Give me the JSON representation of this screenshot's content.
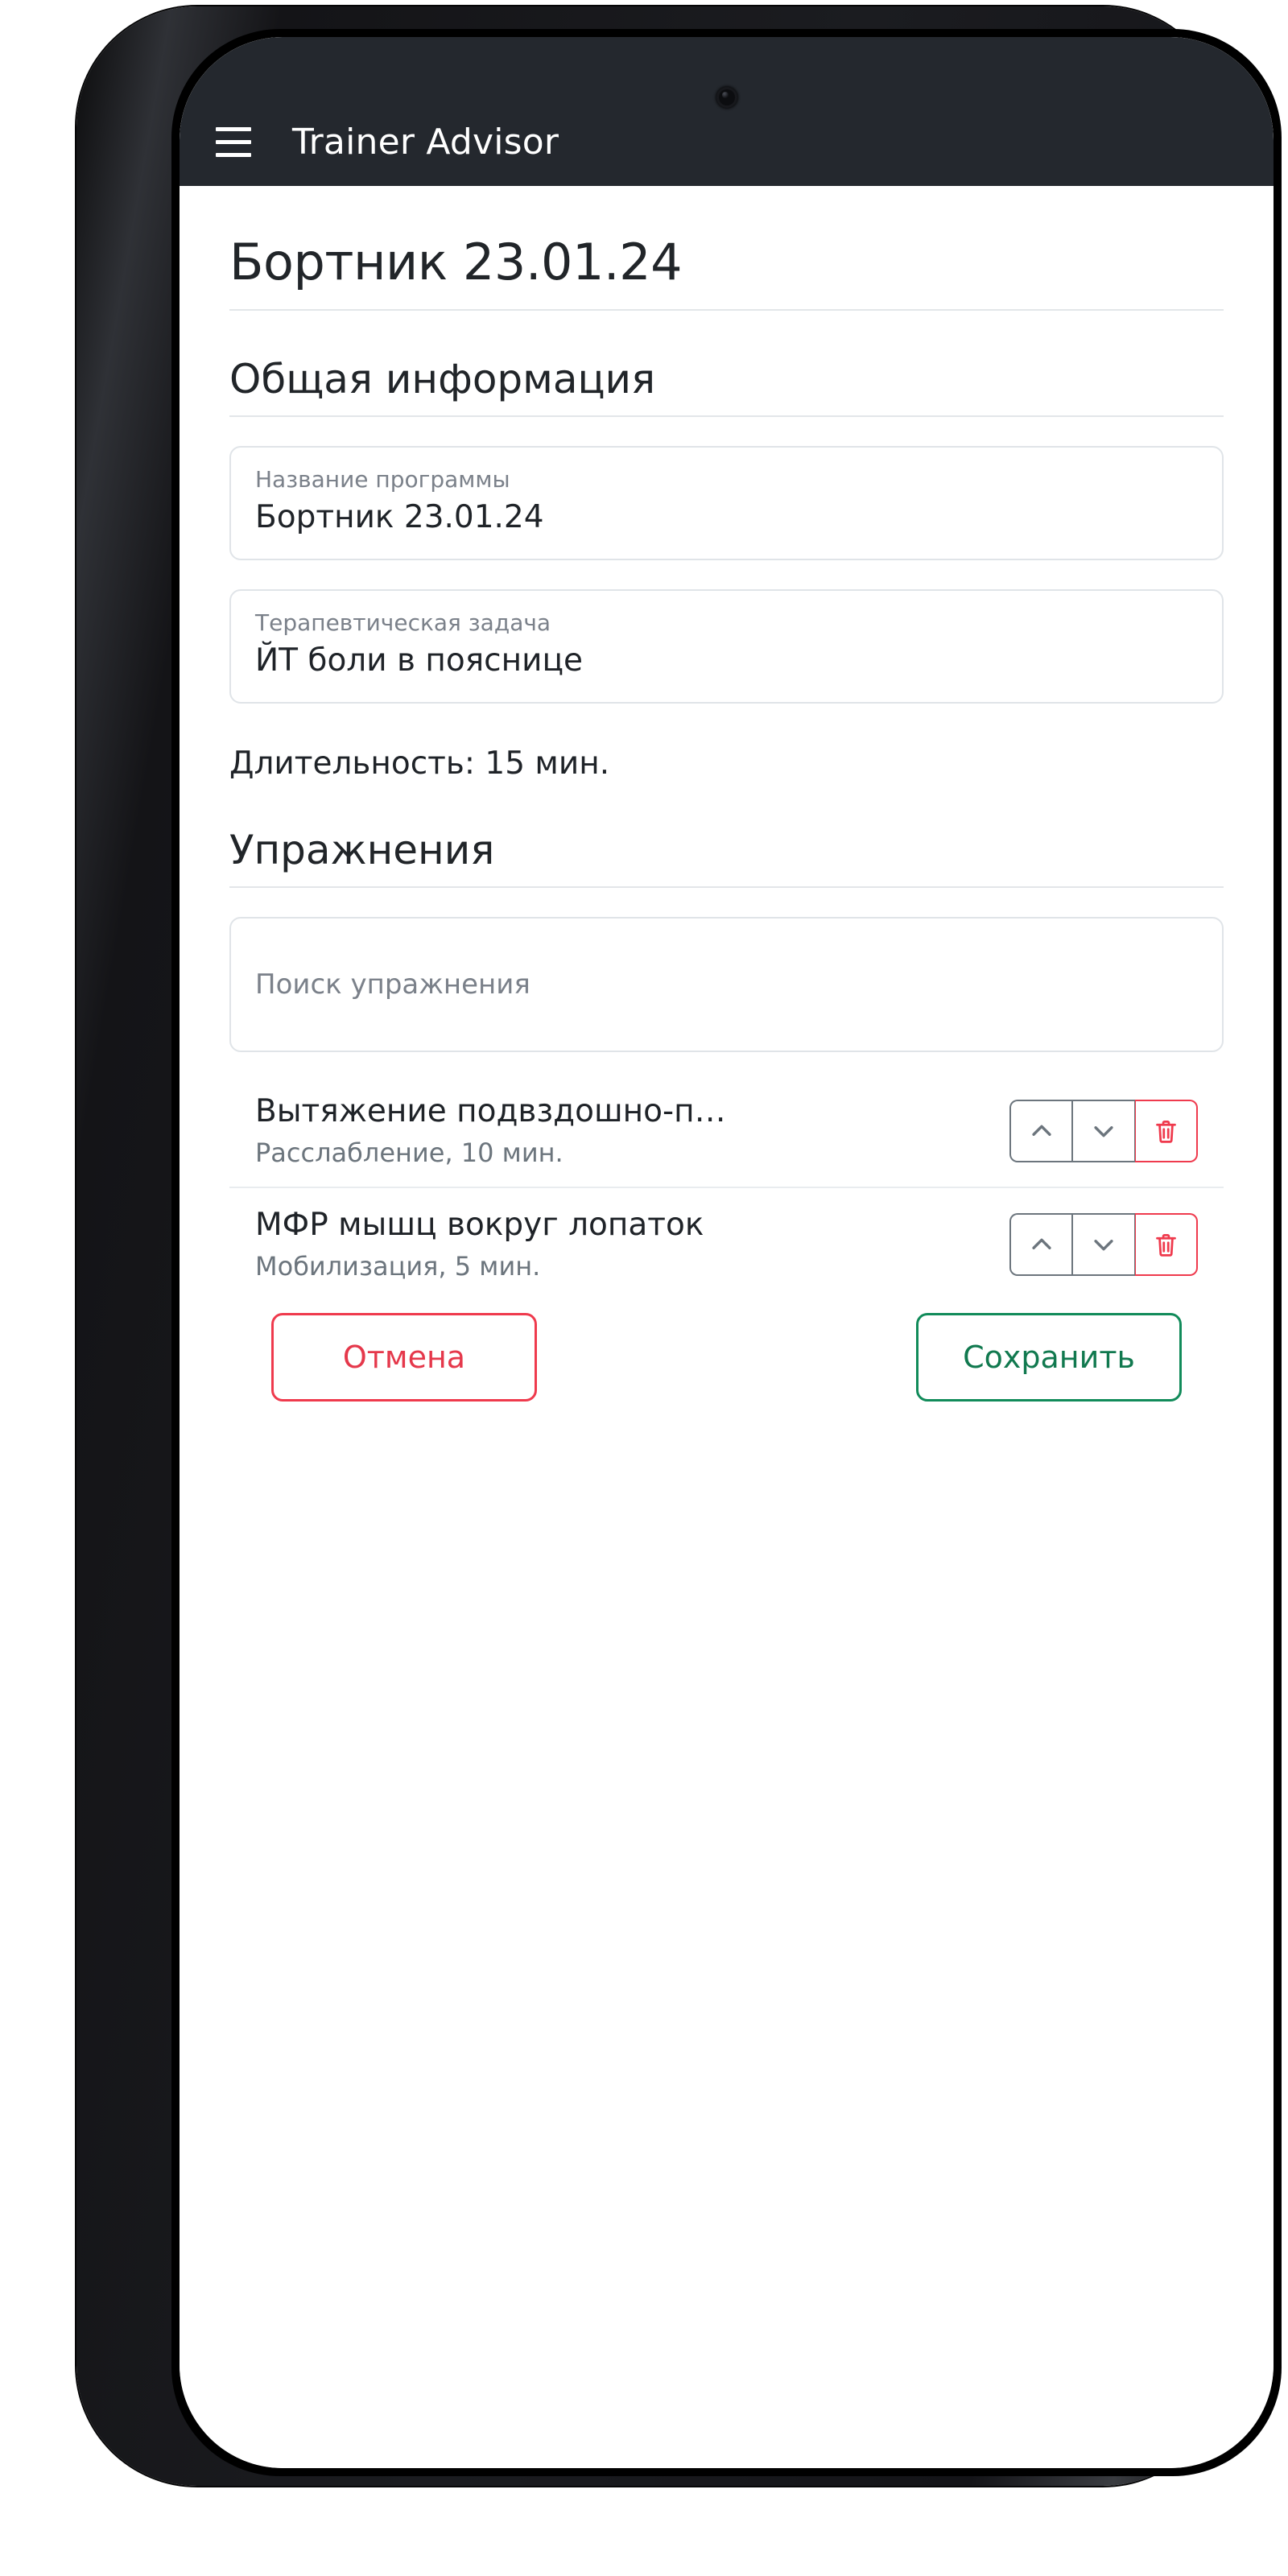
{
  "device": {
    "camera_icon": "camera-punch-hole",
    "side_buttons": [
      "volume-up",
      "volume-down",
      "power"
    ]
  },
  "app_bar": {
    "menu_icon": "hamburger-menu-icon",
    "title": "Trainer Advisor"
  },
  "page": {
    "title": "Бортник 23.01.24"
  },
  "general_section": {
    "heading": "Общая информация",
    "fields": [
      {
        "label": "Название программы",
        "value": "Бортник 23.01.24"
      },
      {
        "label": "Терапевтическая задача",
        "value": "ЙТ боли в пояснице"
      }
    ],
    "duration_text": "Длительность: 15 мин."
  },
  "exercises_section": {
    "heading": "Упражнения",
    "search": {
      "placeholder": "Поиск упражнения",
      "value": ""
    },
    "items": [
      {
        "title": "Вытяжение подвздошно-п…",
        "subtitle": "Расслабление, 10 мин.",
        "move_up_icon": "chevron-up-icon",
        "move_down_icon": "chevron-down-icon",
        "delete_icon": "trash-icon"
      },
      {
        "title": "МФР мышц вокруг лопаток",
        "subtitle": "Мобилизация, 5 мин.",
        "move_up_icon": "chevron-up-icon",
        "move_down_icon": "chevron-down-icon",
        "delete_icon": "trash-icon"
      }
    ]
  },
  "form_actions": {
    "cancel_label": "Отмена",
    "save_label": "Сохранить"
  },
  "colors": {
    "app_bar_bg": "#24282e",
    "text_primary": "#1f2328",
    "text_muted": "#6c757d",
    "border": "#e0e4e8",
    "danger": "#ef3a4d",
    "success": "#118b5a"
  }
}
